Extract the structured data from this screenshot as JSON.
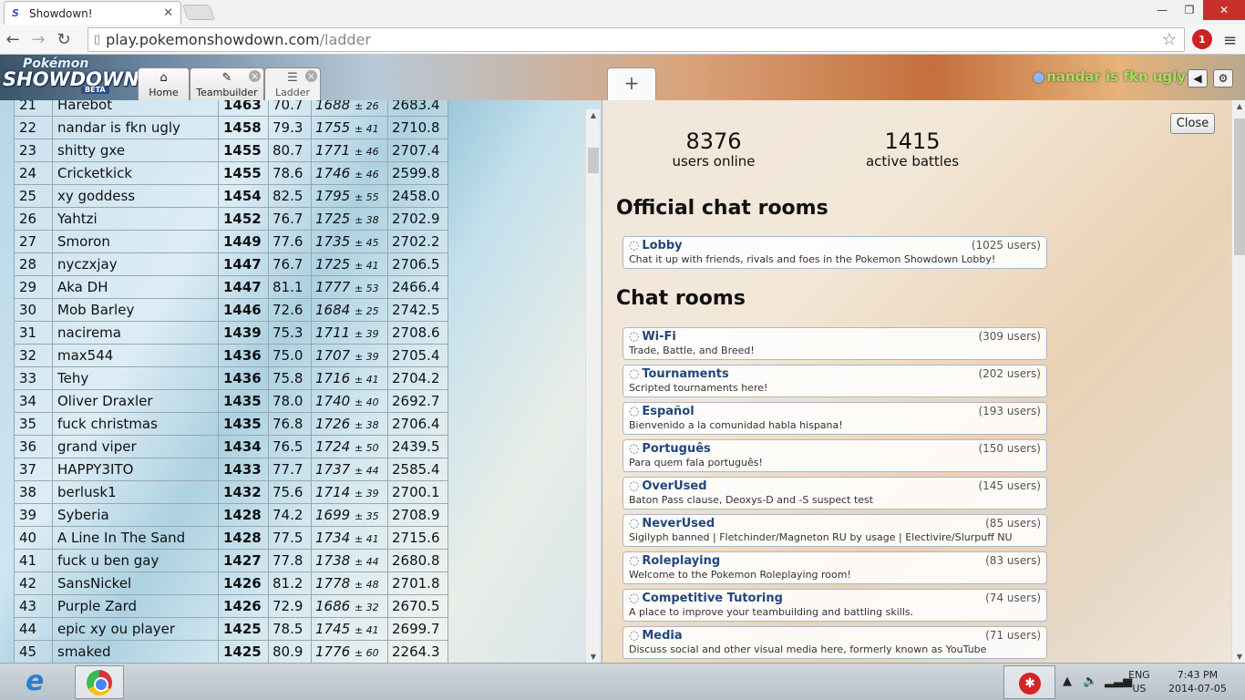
{
  "browser": {
    "tab_title": "Showdown!",
    "tab_close": "✕",
    "url_host": "play.pokemonshowdown.com",
    "url_path": "/ladder",
    "win_min": "—",
    "win_max": "❐",
    "win_close": "✕",
    "extension_badge": "1"
  },
  "header": {
    "logo_line1": "Pokémon",
    "logo_line2": "SHOWDOWN",
    "logo_beta": "BETA",
    "tabs": [
      {
        "label": "Home",
        "icon": "home-icon"
      },
      {
        "label": "Teambuilder",
        "icon": "edit-icon"
      },
      {
        "label": "Ladder",
        "icon": "list-icon"
      }
    ],
    "add_tab": "+",
    "username": "nandar is fkn ugly",
    "sound_glyph": "◀",
    "settings_glyph": "⚙"
  },
  "ladder": {
    "rows": [
      {
        "rank": "21",
        "name": "Harebot",
        "elo": "1463",
        "gxe": "70.7",
        "gl": "1688",
        "dev": "± 26",
        "cre": "2683.4"
      },
      {
        "rank": "22",
        "name": "nandar is fkn ugly",
        "elo": "1458",
        "gxe": "79.3",
        "gl": "1755",
        "dev": "± 41",
        "cre": "2710.8"
      },
      {
        "rank": "23",
        "name": "shitty gxe",
        "elo": "1455",
        "gxe": "80.7",
        "gl": "1771",
        "dev": "± 46",
        "cre": "2707.4"
      },
      {
        "rank": "24",
        "name": "Cricketkick",
        "elo": "1455",
        "gxe": "78.6",
        "gl": "1746",
        "dev": "± 46",
        "cre": "2599.8"
      },
      {
        "rank": "25",
        "name": "xy goddess",
        "elo": "1454",
        "gxe": "82.5",
        "gl": "1795",
        "dev": "± 55",
        "cre": "2458.0"
      },
      {
        "rank": "26",
        "name": "Yahtzi",
        "elo": "1452",
        "gxe": "76.7",
        "gl": "1725",
        "dev": "± 38",
        "cre": "2702.9"
      },
      {
        "rank": "27",
        "name": "Smoron",
        "elo": "1449",
        "gxe": "77.6",
        "gl": "1735",
        "dev": "± 45",
        "cre": "2702.2"
      },
      {
        "rank": "28",
        "name": "nyczxjay",
        "elo": "1447",
        "gxe": "76.7",
        "gl": "1725",
        "dev": "± 41",
        "cre": "2706.5"
      },
      {
        "rank": "29",
        "name": "Aka DH",
        "elo": "1447",
        "gxe": "81.1",
        "gl": "1777",
        "dev": "± 53",
        "cre": "2466.4"
      },
      {
        "rank": "30",
        "name": "Mob Barley",
        "elo": "1446",
        "gxe": "72.6",
        "gl": "1684",
        "dev": "± 25",
        "cre": "2742.5"
      },
      {
        "rank": "31",
        "name": "nacirema",
        "elo": "1439",
        "gxe": "75.3",
        "gl": "1711",
        "dev": "± 39",
        "cre": "2708.6"
      },
      {
        "rank": "32",
        "name": "max544",
        "elo": "1436",
        "gxe": "75.0",
        "gl": "1707",
        "dev": "± 39",
        "cre": "2705.4"
      },
      {
        "rank": "33",
        "name": "Tehy",
        "elo": "1436",
        "gxe": "75.8",
        "gl": "1716",
        "dev": "± 41",
        "cre": "2704.2"
      },
      {
        "rank": "34",
        "name": "Oliver Draxler",
        "elo": "1435",
        "gxe": "78.0",
        "gl": "1740",
        "dev": "± 40",
        "cre": "2692.7"
      },
      {
        "rank": "35",
        "name": "fuck christmas",
        "elo": "1435",
        "gxe": "76.8",
        "gl": "1726",
        "dev": "± 38",
        "cre": "2706.4"
      },
      {
        "rank": "36",
        "name": "grand viper",
        "elo": "1434",
        "gxe": "76.5",
        "gl": "1724",
        "dev": "± 50",
        "cre": "2439.5"
      },
      {
        "rank": "37",
        "name": "HAPPY3ITO",
        "elo": "1433",
        "gxe": "77.7",
        "gl": "1737",
        "dev": "± 44",
        "cre": "2585.4"
      },
      {
        "rank": "38",
        "name": "berlusk1",
        "elo": "1432",
        "gxe": "75.6",
        "gl": "1714",
        "dev": "± 39",
        "cre": "2700.1"
      },
      {
        "rank": "39",
        "name": "Syberia",
        "elo": "1428",
        "gxe": "74.2",
        "gl": "1699",
        "dev": "± 35",
        "cre": "2708.9"
      },
      {
        "rank": "40",
        "name": "A Line In The Sand",
        "elo": "1428",
        "gxe": "77.5",
        "gl": "1734",
        "dev": "± 41",
        "cre": "2715.6"
      },
      {
        "rank": "41",
        "name": "fuck u ben gay",
        "elo": "1427",
        "gxe": "77.8",
        "gl": "1738",
        "dev": "± 44",
        "cre": "2680.8"
      },
      {
        "rank": "42",
        "name": "SansNickel",
        "elo": "1426",
        "gxe": "81.2",
        "gl": "1778",
        "dev": "± 48",
        "cre": "2701.8"
      },
      {
        "rank": "43",
        "name": "Purple Zard",
        "elo": "1426",
        "gxe": "72.9",
        "gl": "1686",
        "dev": "± 32",
        "cre": "2670.5"
      },
      {
        "rank": "44",
        "name": "epic xy ou player",
        "elo": "1425",
        "gxe": "78.5",
        "gl": "1745",
        "dev": "± 41",
        "cre": "2699.7"
      },
      {
        "rank": "45",
        "name": "smaked",
        "elo": "1425",
        "gxe": "80.9",
        "gl": "1776",
        "dev": "± 60",
        "cre": "2264.3"
      }
    ]
  },
  "rooms": {
    "close_label": "Close",
    "users_online_count": "8376",
    "users_online_label": "users online",
    "battles_count": "1415",
    "battles_label": "active battles",
    "official_heading": "Official chat rooms",
    "chat_heading": "Chat rooms",
    "official": [
      {
        "name": "Lobby",
        "users": "(1025 users)",
        "desc": "Chat it up with friends, rivals and foes in the Pokemon Showdown Lobby!"
      }
    ],
    "chat": [
      {
        "name": "Wi-Fi",
        "users": "(309 users)",
        "desc": "Trade, Battle, and Breed!"
      },
      {
        "name": "Tournaments",
        "users": "(202 users)",
        "desc": "Scripted tournaments here!"
      },
      {
        "name": "Español",
        "users": "(193 users)",
        "desc": "Bienvenido a la comunidad habla hispana!"
      },
      {
        "name": "Português",
        "users": "(150 users)",
        "desc": "Para quem fala português!"
      },
      {
        "name": "OverUsed",
        "users": "(145 users)",
        "desc": "Baton Pass clause, Deoxys-D and -S suspect test"
      },
      {
        "name": "NeverUsed",
        "users": "(85 users)",
        "desc": "Sigilyph banned | Fletchinder/Magneton RU by usage | Electivire/Slurpuff NU"
      },
      {
        "name": "Roleplaying",
        "users": "(83 users)",
        "desc": "Welcome to the Pokemon Roleplaying room!"
      },
      {
        "name": "Competitive Tutoring",
        "users": "(74 users)",
        "desc": "A place to improve your teambuilding and battling skills."
      },
      {
        "name": "Media",
        "users": "(71 users)",
        "desc": "Discuss social and other visual media here, formerly known as YouTube"
      }
    ]
  },
  "taskbar": {
    "lang1": "ENG",
    "lang2": "US",
    "time": "7:43 PM",
    "date": "2014-07-05"
  },
  "colors": {
    "username": "#a8e05a",
    "room_name": "#23477a",
    "close_window": "#c8302c"
  }
}
